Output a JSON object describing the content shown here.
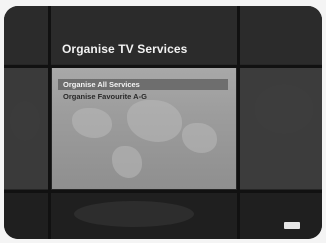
{
  "header": {
    "title": "Organise TV Services"
  },
  "menu": {
    "items": [
      {
        "label": "Organise All Services",
        "selected": true
      },
      {
        "label": "Organise Favourite A-G",
        "selected": false
      }
    ]
  },
  "colors": {
    "background": "#262626",
    "menu_panel": "#9c9c9c",
    "selection": "#6e6e6e",
    "title_text": "#f2f2f2"
  },
  "footer": {
    "badge_icon": "remote-key-icon"
  }
}
